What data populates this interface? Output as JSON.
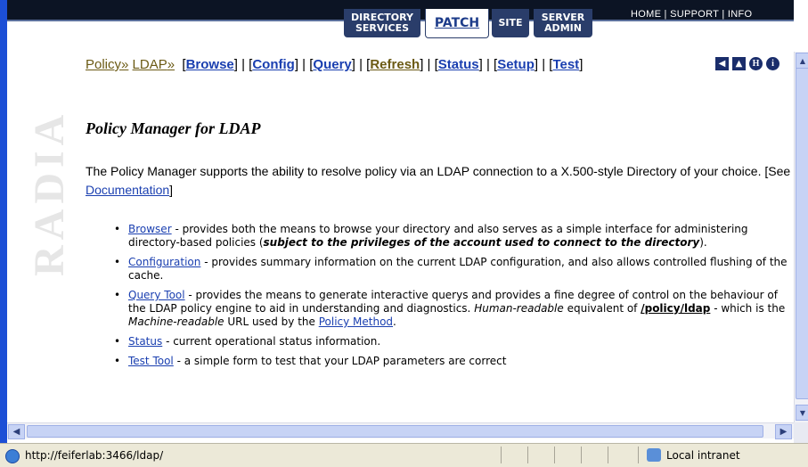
{
  "nav": {
    "tabs": [
      {
        "label": "DIRECTORY SERVICES"
      },
      {
        "label": "PATCH"
      },
      {
        "label": "SITE"
      },
      {
        "label": "SERVER ADMIN"
      }
    ],
    "links": [
      "HOME",
      "SUPPORT",
      "INFO"
    ]
  },
  "logo": {
    "text": "RADIA"
  },
  "breadcrumb": {
    "policy": "Policy",
    "ldap": "LDAP",
    "arrow": "»",
    "items": [
      "Browse",
      "Config",
      "Query",
      "Refresh",
      "Status",
      "Setup",
      "Test"
    ],
    "icons": [
      "back-icon",
      "up-icon",
      "help-icon",
      "info-icon"
    ]
  },
  "page": {
    "title": "Policy Manager for LDAP",
    "intro_text": "The Policy Manager supports the ability to resolve policy via an LDAP connection to a X.500-style Directory of your choice. [See ",
    "intro_link": "Documentation",
    "intro_end": "]"
  },
  "features": [
    {
      "link": "Browser",
      "text": " - provides both the means to browse your directory and also serves as a simple interface for administering directory-based policies (",
      "emph": "subject to the privileges of the account used to connect to the directory",
      "after": ")."
    },
    {
      "link": "Configuration",
      "text": " - provides summary information on the current LDAP configuration, and also allows controlled flushing of the cache."
    },
    {
      "link": "Query Tool",
      "text": " - provides the means to generate interactive querys and provides a fine degree of control on the behaviour of the LDAP policy engine to aid in understanding and diagnostics. ",
      "italic1": "Human-readable",
      "text2": " equivalent of ",
      "code": "/policy/ldap",
      "text3": " - which is the ",
      "italic2": "Machine-readable",
      "text4": " URL used by the ",
      "link2": "Policy Method",
      "text5": "."
    },
    {
      "link": "Status",
      "text": " - current operational status information."
    },
    {
      "link": "Test Tool",
      "text": " - a simple form to test that your LDAP parameters are correct"
    }
  ],
  "statusbar": {
    "url": "http://feiferlab:3466/ldap/",
    "zone": "Local intranet"
  }
}
